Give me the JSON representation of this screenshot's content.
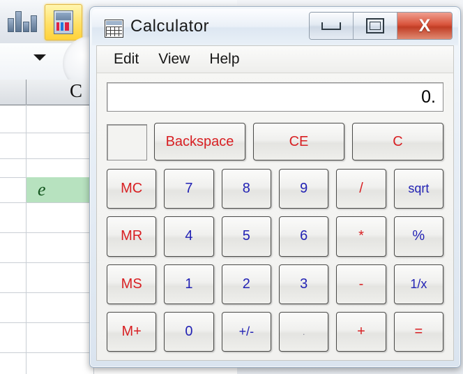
{
  "background_app": {
    "name": "spreadsheet-background",
    "ribbon_icons": [
      "chart-bars-icon",
      "window-panes-icon",
      "dropdown-arrow-icon"
    ],
    "toolbar_dropdown": "dropdown-arrow-icon",
    "column_header_label": "C",
    "highlighted_cell_value": "e",
    "highlighted_cell_color": "#b7e2bf",
    "highlighted_cell_text_color": "#14561f"
  },
  "calculator": {
    "title": "Calculator",
    "title_icon": "calculator-icon",
    "window_buttons": {
      "minimize": "minimize-icon",
      "maximize": "restore-icon",
      "close": "X"
    },
    "menu": [
      {
        "label": "Edit"
      },
      {
        "label": "View"
      },
      {
        "label": "Help"
      }
    ],
    "display_value": "0.",
    "memory_indicator": "",
    "top_row": [
      {
        "label": "Backspace",
        "color": "red"
      },
      {
        "label": "CE",
        "color": "red"
      },
      {
        "label": "C",
        "color": "red"
      }
    ],
    "keys": [
      {
        "label": "MC",
        "color": "red"
      },
      {
        "label": "7",
        "color": "blue"
      },
      {
        "label": "8",
        "color": "blue"
      },
      {
        "label": "9",
        "color": "blue"
      },
      {
        "label": "/",
        "color": "red"
      },
      {
        "label": "sqrt",
        "color": "blue",
        "small": true
      },
      {
        "label": "MR",
        "color": "red"
      },
      {
        "label": "4",
        "color": "blue"
      },
      {
        "label": "5",
        "color": "blue"
      },
      {
        "label": "6",
        "color": "blue"
      },
      {
        "label": "*",
        "color": "red"
      },
      {
        "label": "%",
        "color": "blue"
      },
      {
        "label": "MS",
        "color": "red"
      },
      {
        "label": "1",
        "color": "blue"
      },
      {
        "label": "2",
        "color": "blue"
      },
      {
        "label": "3",
        "color": "blue"
      },
      {
        "label": "-",
        "color": "red"
      },
      {
        "label": "1/x",
        "color": "blue",
        "small": true
      },
      {
        "label": "M+",
        "color": "red"
      },
      {
        "label": "0",
        "color": "blue"
      },
      {
        "label": "+/-",
        "color": "blue",
        "small": true
      },
      {
        "label": ".",
        "color": "dot"
      },
      {
        "label": "+",
        "color": "red"
      },
      {
        "label": "=",
        "color": "red"
      }
    ],
    "accent_colors": {
      "number_blue": "#2222b4",
      "operator_red": "#d81f22",
      "close_button_red": "#c13d25"
    }
  }
}
